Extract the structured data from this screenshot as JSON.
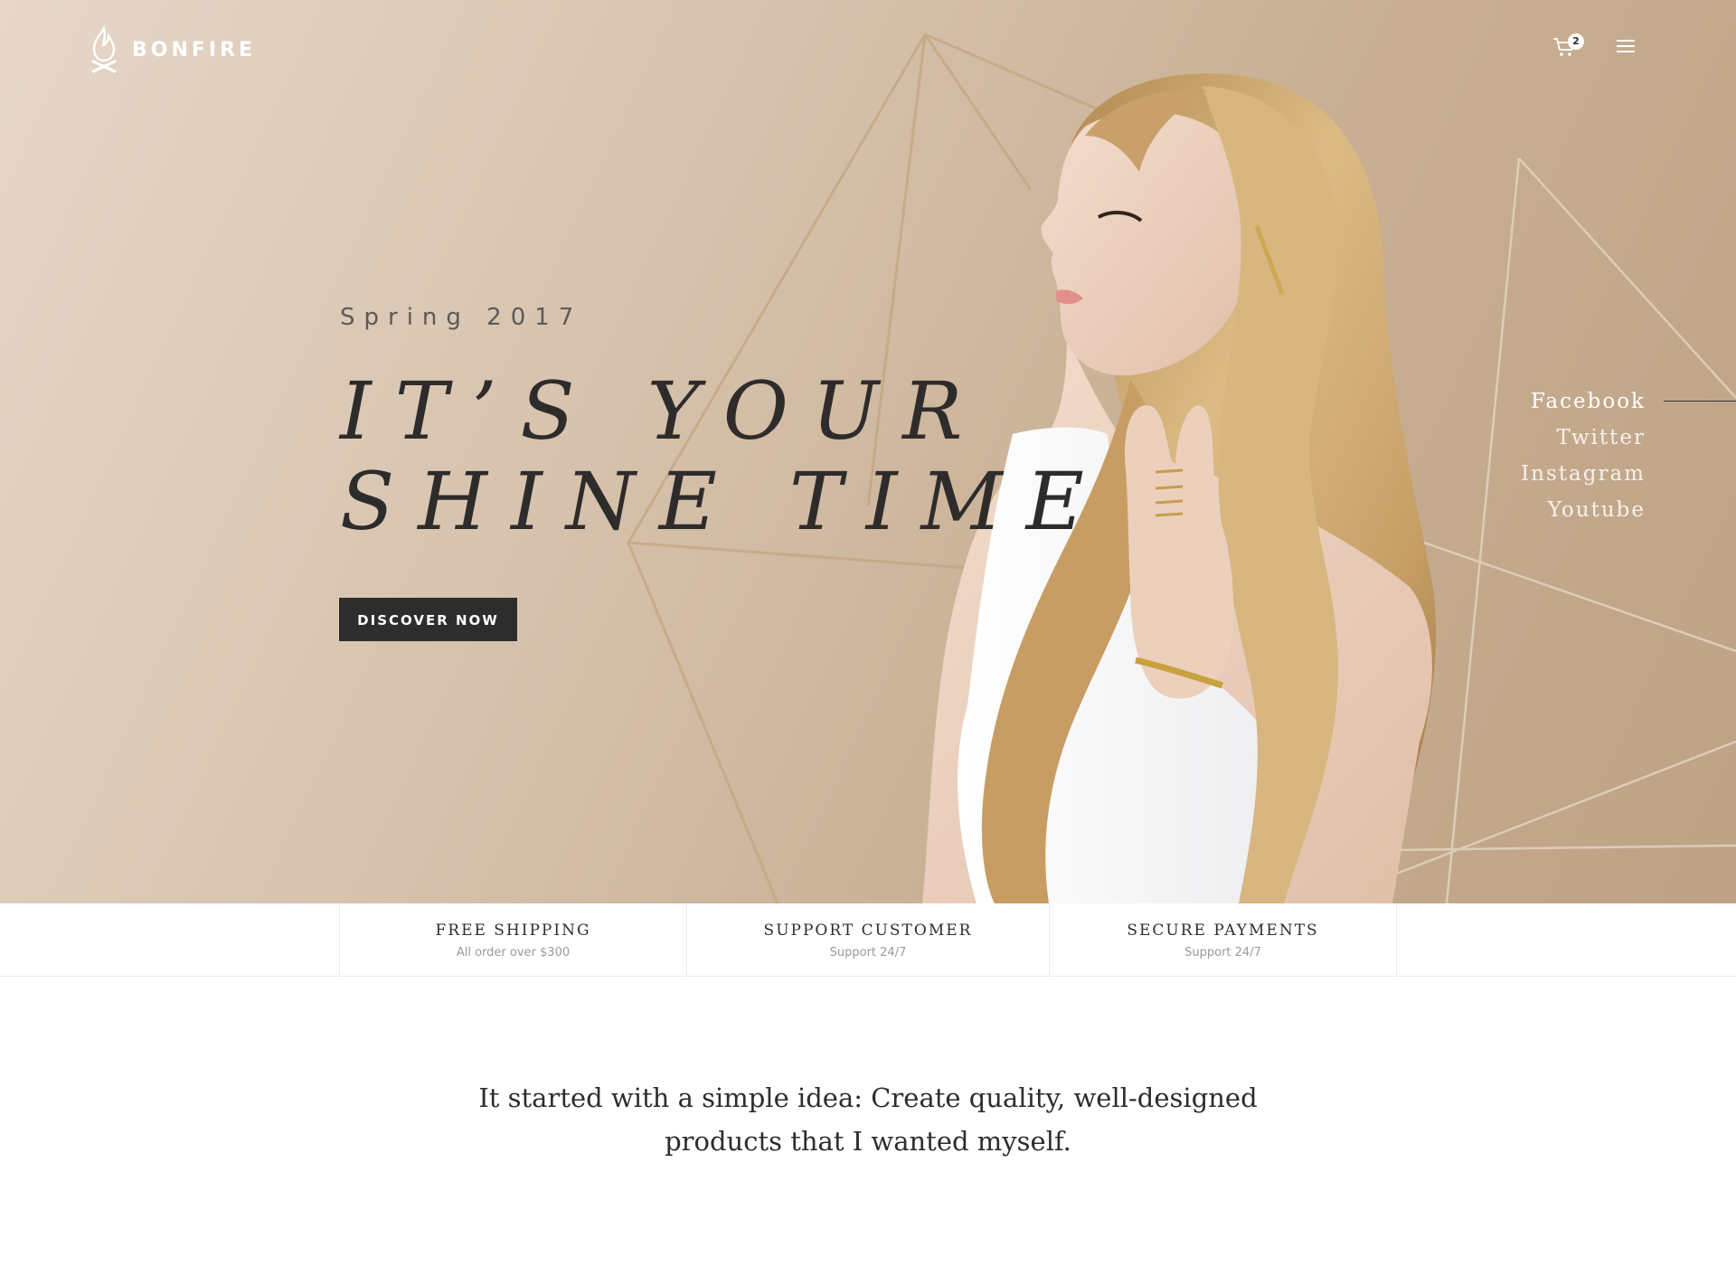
{
  "brand": {
    "name": "BONFIRE",
    "logo_icon": "flame-icon"
  },
  "header": {
    "cart_count": "2",
    "cart_icon": "cart-icon",
    "menu_icon": "hamburger-menu-icon"
  },
  "hero": {
    "season": "Spring 2017",
    "headline_line1": "IT’S YOUR",
    "headline_line2": "SHINE TIME",
    "cta_label": "DISCOVER NOW"
  },
  "social": {
    "items": [
      {
        "label": "Facebook",
        "active": true
      },
      {
        "label": "Twitter",
        "active": false
      },
      {
        "label": "Instagram",
        "active": false
      },
      {
        "label": "Youtube",
        "active": false
      }
    ]
  },
  "features": [
    {
      "title": "FREE SHIPPING",
      "subtitle": "All order over $300"
    },
    {
      "title": "SUPPORT CUSTOMER",
      "subtitle": "Support 24/7"
    },
    {
      "title": "SECURE PAYMENTS",
      "subtitle": "Support 24/7"
    }
  ],
  "intro": {
    "text": "It started with a simple idea: Create quality, well-designed products that I wanted myself."
  },
  "colors": {
    "hero_bg_start": "#e6d7c9",
    "hero_bg_end": "#bea285",
    "dark": "#2d2d2d",
    "muted": "#9a9a9a",
    "line_gold": "#c9ad86"
  }
}
